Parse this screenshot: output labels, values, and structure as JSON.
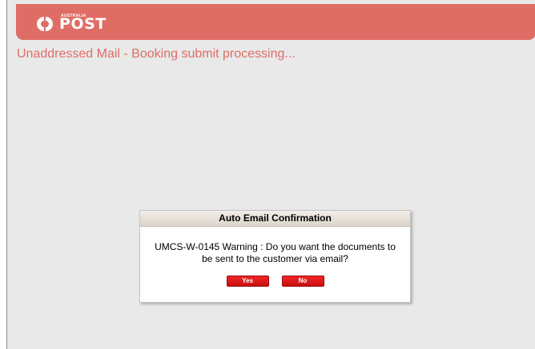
{
  "header": {
    "logo_small": "AUSTRALIA",
    "logo_word": "POST"
  },
  "page": {
    "title": "Unaddressed Mail - Booking submit processing..."
  },
  "dialog": {
    "title": "Auto Email Confirmation",
    "message": "UMCS-W-0145 Warning : Do you want the documents to be sent to the customer via email?",
    "yes_label": "Yes",
    "no_label": "No"
  },
  "colors": {
    "brand_header": "#df6d65",
    "page_background": "#e9e9e9",
    "button_red": "#e01b1b"
  }
}
